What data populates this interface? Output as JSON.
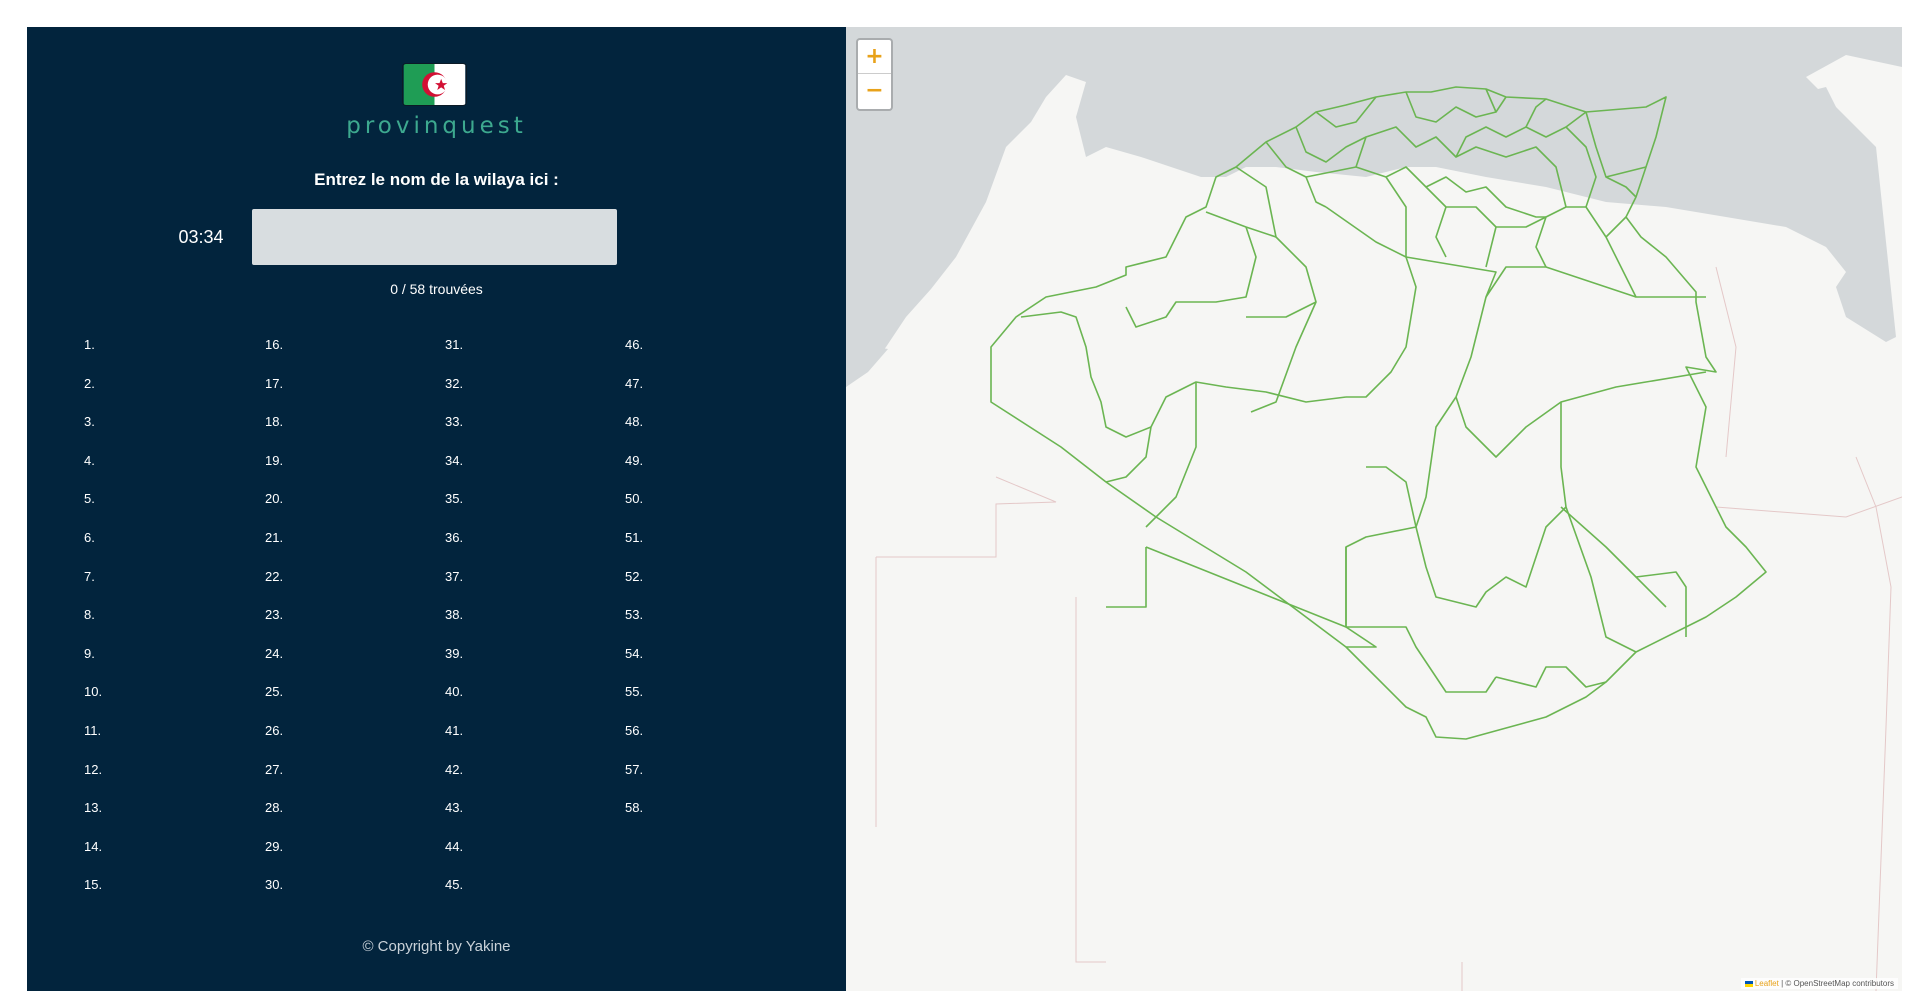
{
  "brand": {
    "name": "provinquest"
  },
  "quiz": {
    "prompt": "Entrez le nom de la wilaya ici :",
    "timer": "03:34",
    "input_value": "",
    "input_placeholder": "",
    "found": "0 / 58 trouvées"
  },
  "answers": {
    "columns": [
      [
        "1.",
        "2.",
        "3.",
        "4.",
        "5.",
        "6.",
        "7.",
        "8.",
        "9.",
        "10.",
        "11.",
        "12.",
        "13.",
        "14.",
        "15."
      ],
      [
        "16.",
        "17.",
        "18.",
        "19.",
        "20.",
        "21.",
        "22.",
        "23.",
        "24.",
        "25.",
        "26.",
        "27.",
        "28.",
        "29.",
        "30."
      ],
      [
        "31.",
        "32.",
        "33.",
        "34.",
        "35.",
        "36.",
        "37.",
        "38.",
        "39.",
        "40.",
        "41.",
        "42.",
        "43.",
        "44.",
        "45."
      ],
      [
        "46.",
        "47.",
        "48.",
        "49.",
        "50.",
        "51.",
        "52.",
        "53.",
        "54.",
        "55.",
        "56.",
        "57.",
        "58."
      ]
    ]
  },
  "footer": {
    "copyright": "© Copyright by Yakine"
  },
  "map": {
    "zoom_in": "+",
    "zoom_out": "−",
    "attribution_leaflet": "Leaflet",
    "attribution_rest": " | © OpenStreetMap contributors"
  },
  "colors": {
    "panel_bg": "#02243d",
    "brand_accent": "#3da98f",
    "border_green": "#6bb552",
    "sea": "#d4d8da",
    "land": "#f6f6f4"
  },
  "icons": {
    "flag": "algeria-flag-icon"
  }
}
